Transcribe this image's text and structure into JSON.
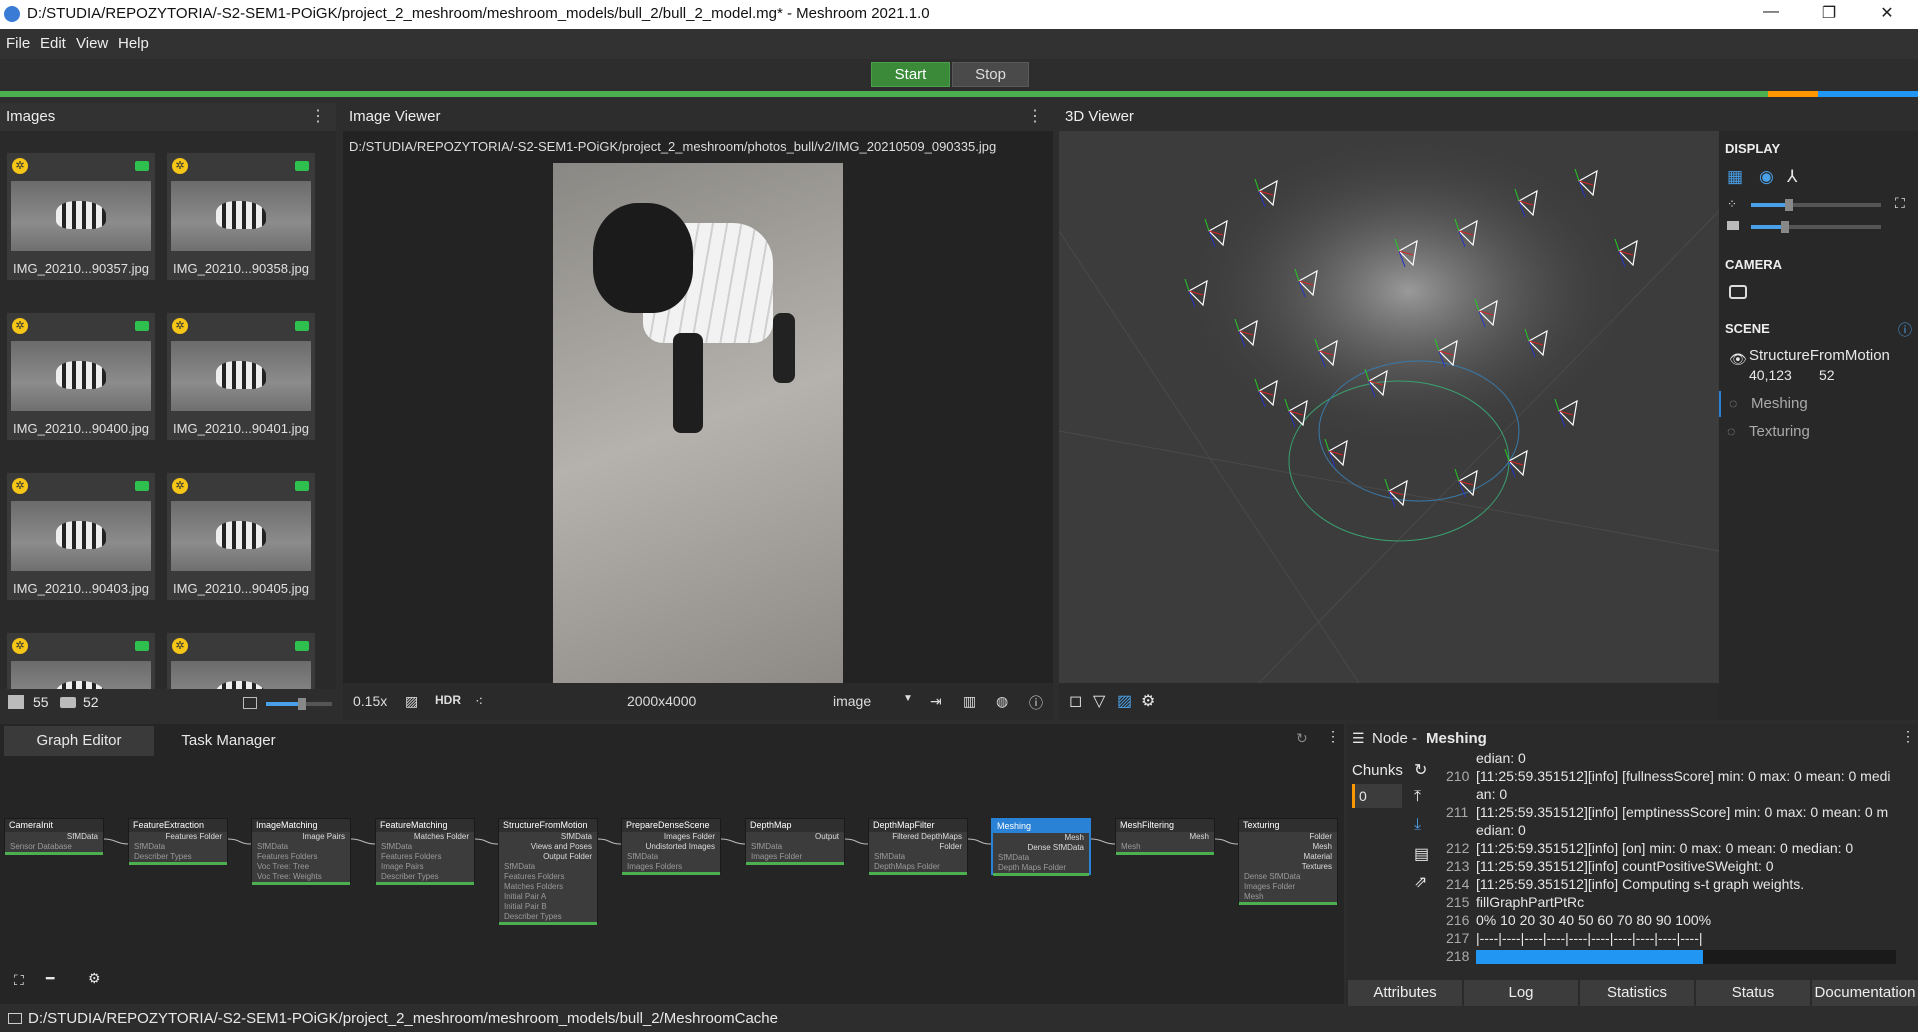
{
  "window": {
    "title": "D:/STUDIA/REPOZYTORIA/-S2-SEM1-POiGK/project_2_meshroom/meshroom_models/bull_2/bull_2_model.mg* - Meshroom 2021.1.0",
    "minimize": "—",
    "restore": "❐",
    "close": "✕"
  },
  "menu": [
    "File",
    "Edit",
    "View",
    "Help"
  ],
  "toolbar": {
    "start": "Start",
    "stop": "Stop"
  },
  "images_panel": {
    "title": "Images",
    "count_images": "55",
    "count_cameras": "52",
    "thumbs": [
      "IMG_20210...90357.jpg",
      "IMG_20210...90358.jpg",
      "IMG_20210...90400.jpg",
      "IMG_20210...90401.jpg",
      "IMG_20210...90403.jpg",
      "IMG_20210...90405.jpg"
    ]
  },
  "image_viewer": {
    "title": "Image Viewer",
    "path": "D:/STUDIA/REPOZYTORIA/-S2-SEM1-POiGK/project_2_meshroom/photos_bull/v2/IMG_20210509_090335.jpg",
    "zoom": "0.15x",
    "hdr": "HDR",
    "resolution": "2000x4000",
    "mode": "image"
  },
  "viewer3d": {
    "title": "3D Viewer"
  },
  "display": {
    "display_label": "DISPLAY",
    "camera_label": "CAMERA",
    "scene_label": "SCENE",
    "scene_items": [
      {
        "name": "StructureFromMotion",
        "points": "40,123",
        "cams": "52"
      },
      {
        "name": "Meshing"
      },
      {
        "name": "Texturing"
      }
    ]
  },
  "graph": {
    "tabs": [
      "Graph Editor",
      "Task Manager"
    ],
    "nodes": [
      {
        "name": "CameraInit",
        "outs": [
          "SfMData"
        ],
        "ins": [
          "Sensor Database"
        ]
      },
      {
        "name": "FeatureExtraction",
        "outs": [
          "Features Folder"
        ],
        "ins": [
          "SfMData",
          "Describer Types"
        ]
      },
      {
        "name": "ImageMatching",
        "outs": [
          "Image Pairs"
        ],
        "ins": [
          "SfMData",
          "Features Folders",
          "Voc Tree: Tree",
          "Voc Tree: Weights"
        ]
      },
      {
        "name": "FeatureMatching",
        "outs": [
          "Matches Folder"
        ],
        "ins": [
          "SfMData",
          "Features Folders",
          "Image Pairs",
          "Describer Types"
        ]
      },
      {
        "name": "StructureFromMotion",
        "outs": [
          "SfMData",
          "Views and Poses",
          "Output Folder"
        ],
        "ins": [
          "SfMData",
          "Features Folders",
          "Matches Folders",
          "Initial Pair A",
          "Initial Pair B",
          "Describer Types"
        ]
      },
      {
        "name": "PrepareDenseScene",
        "outs": [
          "Images Folder",
          "Undistorted Images"
        ],
        "ins": [
          "SfMData",
          "Images Folders"
        ]
      },
      {
        "name": "DepthMap",
        "outs": [
          "Output"
        ],
        "ins": [
          "SfMData",
          "Images Folder"
        ]
      },
      {
        "name": "DepthMapFilter",
        "outs": [
          "Filtered DepthMaps Folder"
        ],
        "ins": [
          "SfMData",
          "DepthMaps Folder"
        ]
      },
      {
        "name": "Meshing",
        "outs": [
          "Mesh",
          "Dense SfMData"
        ],
        "ins": [
          "SfMData",
          "Depth Maps Folder"
        ]
      },
      {
        "name": "MeshFiltering",
        "outs": [
          "Mesh"
        ],
        "ins": [
          "Mesh"
        ]
      },
      {
        "name": "Texturing",
        "outs": [
          "Folder",
          "Mesh",
          "Material",
          "Textures"
        ],
        "ins": [
          "Dense SfMData",
          "Images Folder",
          "Mesh"
        ]
      }
    ]
  },
  "node_panel": {
    "prefix": "Node - ",
    "node": "Meshing",
    "chunks_label": "Chunks",
    "chunk": "0",
    "log": [
      {
        "n": "",
        "t": "edian: 0"
      },
      {
        "n": "210",
        "t": "[11:25:59.351512][info]  [fullnessScore] min: 0 max: 0 mean: 0 medi"
      },
      {
        "n": "",
        "t": "an: 0"
      },
      {
        "n": "211",
        "t": "[11:25:59.351512][info]  [emptinessScore] min: 0 max: 0 mean: 0 m"
      },
      {
        "n": "",
        "t": "edian: 0"
      },
      {
        "n": "212",
        "t": "[11:25:59.351512][info]  [on] min: 0 max: 0 mean: 0 median: 0"
      },
      {
        "n": "213",
        "t": "[11:25:59.351512][info] countPositiveSWeight: 0"
      },
      {
        "n": "214",
        "t": "[11:25:59.351512][info] Computing s-t graph weights."
      },
      {
        "n": "215",
        "t": "fillGraphPartPtRc"
      },
      {
        "n": "216",
        "t": "0%   10   20   30   40   50   60   70   80   90   100%"
      },
      {
        "n": "217",
        "t": "|----|----|----|----|----|----|----|----|----|----|"
      },
      {
        "n": "218",
        "t": ""
      }
    ],
    "log_progress": 0.54,
    "tabs": [
      "Attributes",
      "Log",
      "Statistics",
      "Status",
      "Documentation"
    ]
  },
  "status": {
    "path": "D:/STUDIA/REPOZYTORIA/-S2-SEM1-POiGK/project_2_meshroom/meshroom_models/bull_2/MeshroomCache"
  },
  "colors": {
    "accent": "#2a82d6",
    "progress": "#4caf50",
    "start": "#3a8a3a"
  }
}
